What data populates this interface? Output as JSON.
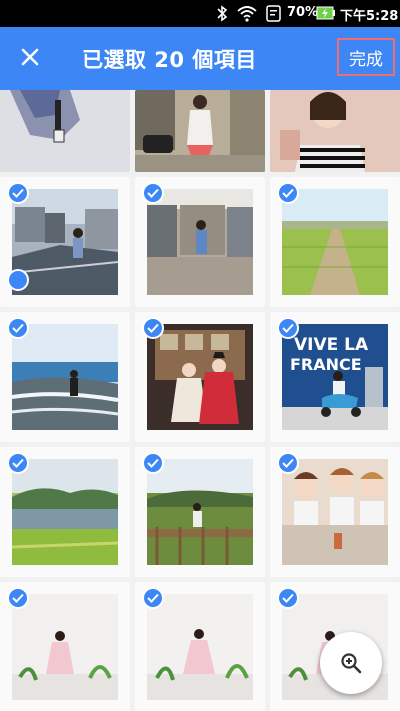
{
  "status_bar": {
    "battery": "70%",
    "time": "下午5:28"
  },
  "header": {
    "title": "已選取 20 個項目",
    "done_label": "完成"
  },
  "icons": {
    "close": "close-icon",
    "zoom": "zoom-in-icon",
    "check": "check-icon"
  },
  "colors": {
    "accent": "#3d86f6",
    "done_outline": "#f06d6d"
  },
  "photos": [
    {
      "subject": "woman in striped top",
      "selected": true
    },
    {
      "subject": "woman dancing on street",
      "selected": true
    },
    {
      "subject": "woman in striped tank",
      "selected": true
    },
    {
      "subject": "woman on rooftop town view",
      "selected": true,
      "checked_visible": true
    },
    {
      "subject": "woman on gravel street",
      "selected": true,
      "checked_visible": true
    },
    {
      "subject": "green rice field",
      "selected": true,
      "checked_visible": true
    },
    {
      "subject": "woman on rocky seashore",
      "selected": true,
      "checked_visible": true
    },
    {
      "subject": "two women in hanbok",
      "selected": true,
      "checked_visible": true
    },
    {
      "subject": "woman on blue scooter VIVE LA FRANCE",
      "selected": true,
      "checked_visible": true,
      "caption": "VIVE LA FRANCE"
    },
    {
      "subject": "lake with green hills",
      "selected": true,
      "checked_visible": true
    },
    {
      "subject": "woman on wooden deck",
      "selected": true,
      "checked_visible": true
    },
    {
      "subject": "girls group selfie",
      "selected": true,
      "checked_visible": true
    },
    {
      "subject": "woman with plants",
      "selected": true,
      "checked_visible": true
    },
    {
      "subject": "woman with plants 2",
      "selected": true,
      "checked_visible": true
    },
    {
      "subject": "woman with plants 3",
      "selected": true,
      "checked_visible": true
    }
  ]
}
